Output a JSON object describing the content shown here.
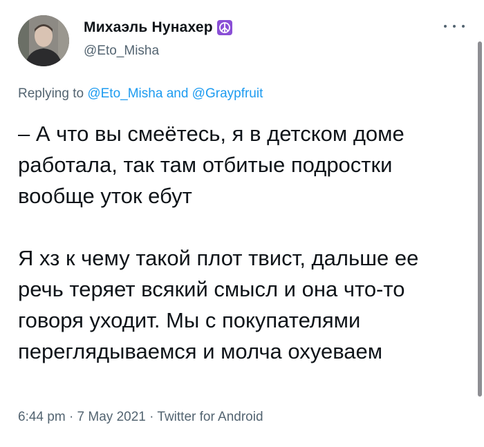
{
  "author": {
    "display_name": "Михаэль Нунахер",
    "badge_icon": "peace-symbol-icon",
    "badge_color": "#8a4fd6",
    "handle": "@Eto_Misha"
  },
  "reply": {
    "prefix": "Replying to",
    "mention_1": "@Eto_Misha",
    "conjunction": "and",
    "mention_2": "@Graypfruit"
  },
  "tweet": {
    "text": "– А что вы смеётесь, я в детском доме работала, так там отбитые подростки вообще уток ебут\n\nЯ хз к чему такой плот твист, дальше ее речь теряет всякий смысл и она что-то говоря уходит. Мы с покупателями переглядываемся и молча охуеваем"
  },
  "meta": {
    "time": "6:44 pm",
    "date": "7 May 2021",
    "source": "Twitter for Android",
    "separator": "·"
  },
  "colors": {
    "link": "#1d9bf0",
    "secondary_text": "#536471",
    "primary_text": "#0f1419"
  }
}
